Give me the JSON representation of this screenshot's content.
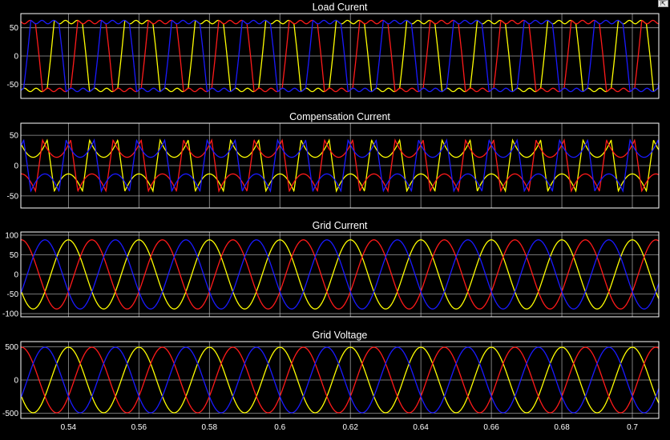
{
  "window": {
    "restore_icon": "restore-axes-icon"
  },
  "colors": {
    "background": "#000000",
    "grid": "#cfcfcf",
    "axis_frame": "#ffffff",
    "phase_a": "#ffff00",
    "phase_b": "#ff1a1a",
    "phase_c": "#1a1aff"
  },
  "chart_data": [
    {
      "type": "line",
      "title": "Load Curent",
      "waveform": "quasi-square",
      "amplitude": 60,
      "frequency_hz": 50,
      "ylim": [
        -75,
        75
      ],
      "yticks": [
        50,
        0,
        -50
      ],
      "xlim": [
        0.5265,
        0.7075
      ],
      "grid": true,
      "series": [
        {
          "color": "#ffff00",
          "phase_deg": 90
        },
        {
          "color": "#ff1a1a",
          "phase_deg": -30
        },
        {
          "color": "#1a1aff",
          "phase_deg": 210
        }
      ]
    },
    {
      "type": "line",
      "title": "Compensation Current",
      "waveform": "compensation",
      "amplitude": 55,
      "frequency_hz": 50,
      "ylim": [
        -70,
        70
      ],
      "yticks": [
        50,
        0,
        -50
      ],
      "xlim": [
        0.5265,
        0.7075
      ],
      "grid": true,
      "series": [
        {
          "color": "#ffff00",
          "phase_deg": 90
        },
        {
          "color": "#ff1a1a",
          "phase_deg": -30
        },
        {
          "color": "#1a1aff",
          "phase_deg": 210
        }
      ]
    },
    {
      "type": "line",
      "title": "Grid Current",
      "waveform": "sine",
      "amplitude": 88,
      "frequency_hz": 50,
      "ylim": [
        -108,
        108
      ],
      "yticks": [
        100,
        50,
        0,
        -50,
        -100
      ],
      "xlim": [
        0.5265,
        0.7075
      ],
      "grid": true,
      "series": [
        {
          "color": "#ffff00",
          "phase_deg": 90
        },
        {
          "color": "#ff1a1a",
          "phase_deg": -30
        },
        {
          "color": "#1a1aff",
          "phase_deg": 210
        }
      ]
    },
    {
      "type": "line",
      "title": "Grid Voltage",
      "waveform": "sine",
      "amplitude": 495,
      "frequency_hz": 50,
      "ylim": [
        -580,
        580
      ],
      "yticks": [
        500,
        0,
        -500
      ],
      "xlim": [
        0.5265,
        0.7075
      ],
      "xticks": [
        0.54,
        0.56,
        0.58,
        0.6,
        0.62,
        0.64,
        0.66,
        0.68,
        0.7
      ],
      "xticklabels": [
        "0.54",
        "0.56",
        "0.58",
        "0.6",
        "0.62",
        "0.64",
        "0.66",
        "0.68",
        "0.7"
      ],
      "grid": true,
      "series": [
        {
          "color": "#ffff00",
          "phase_deg": 90
        },
        {
          "color": "#ff1a1a",
          "phase_deg": -30
        },
        {
          "color": "#1a1aff",
          "phase_deg": 210
        }
      ]
    }
  ]
}
